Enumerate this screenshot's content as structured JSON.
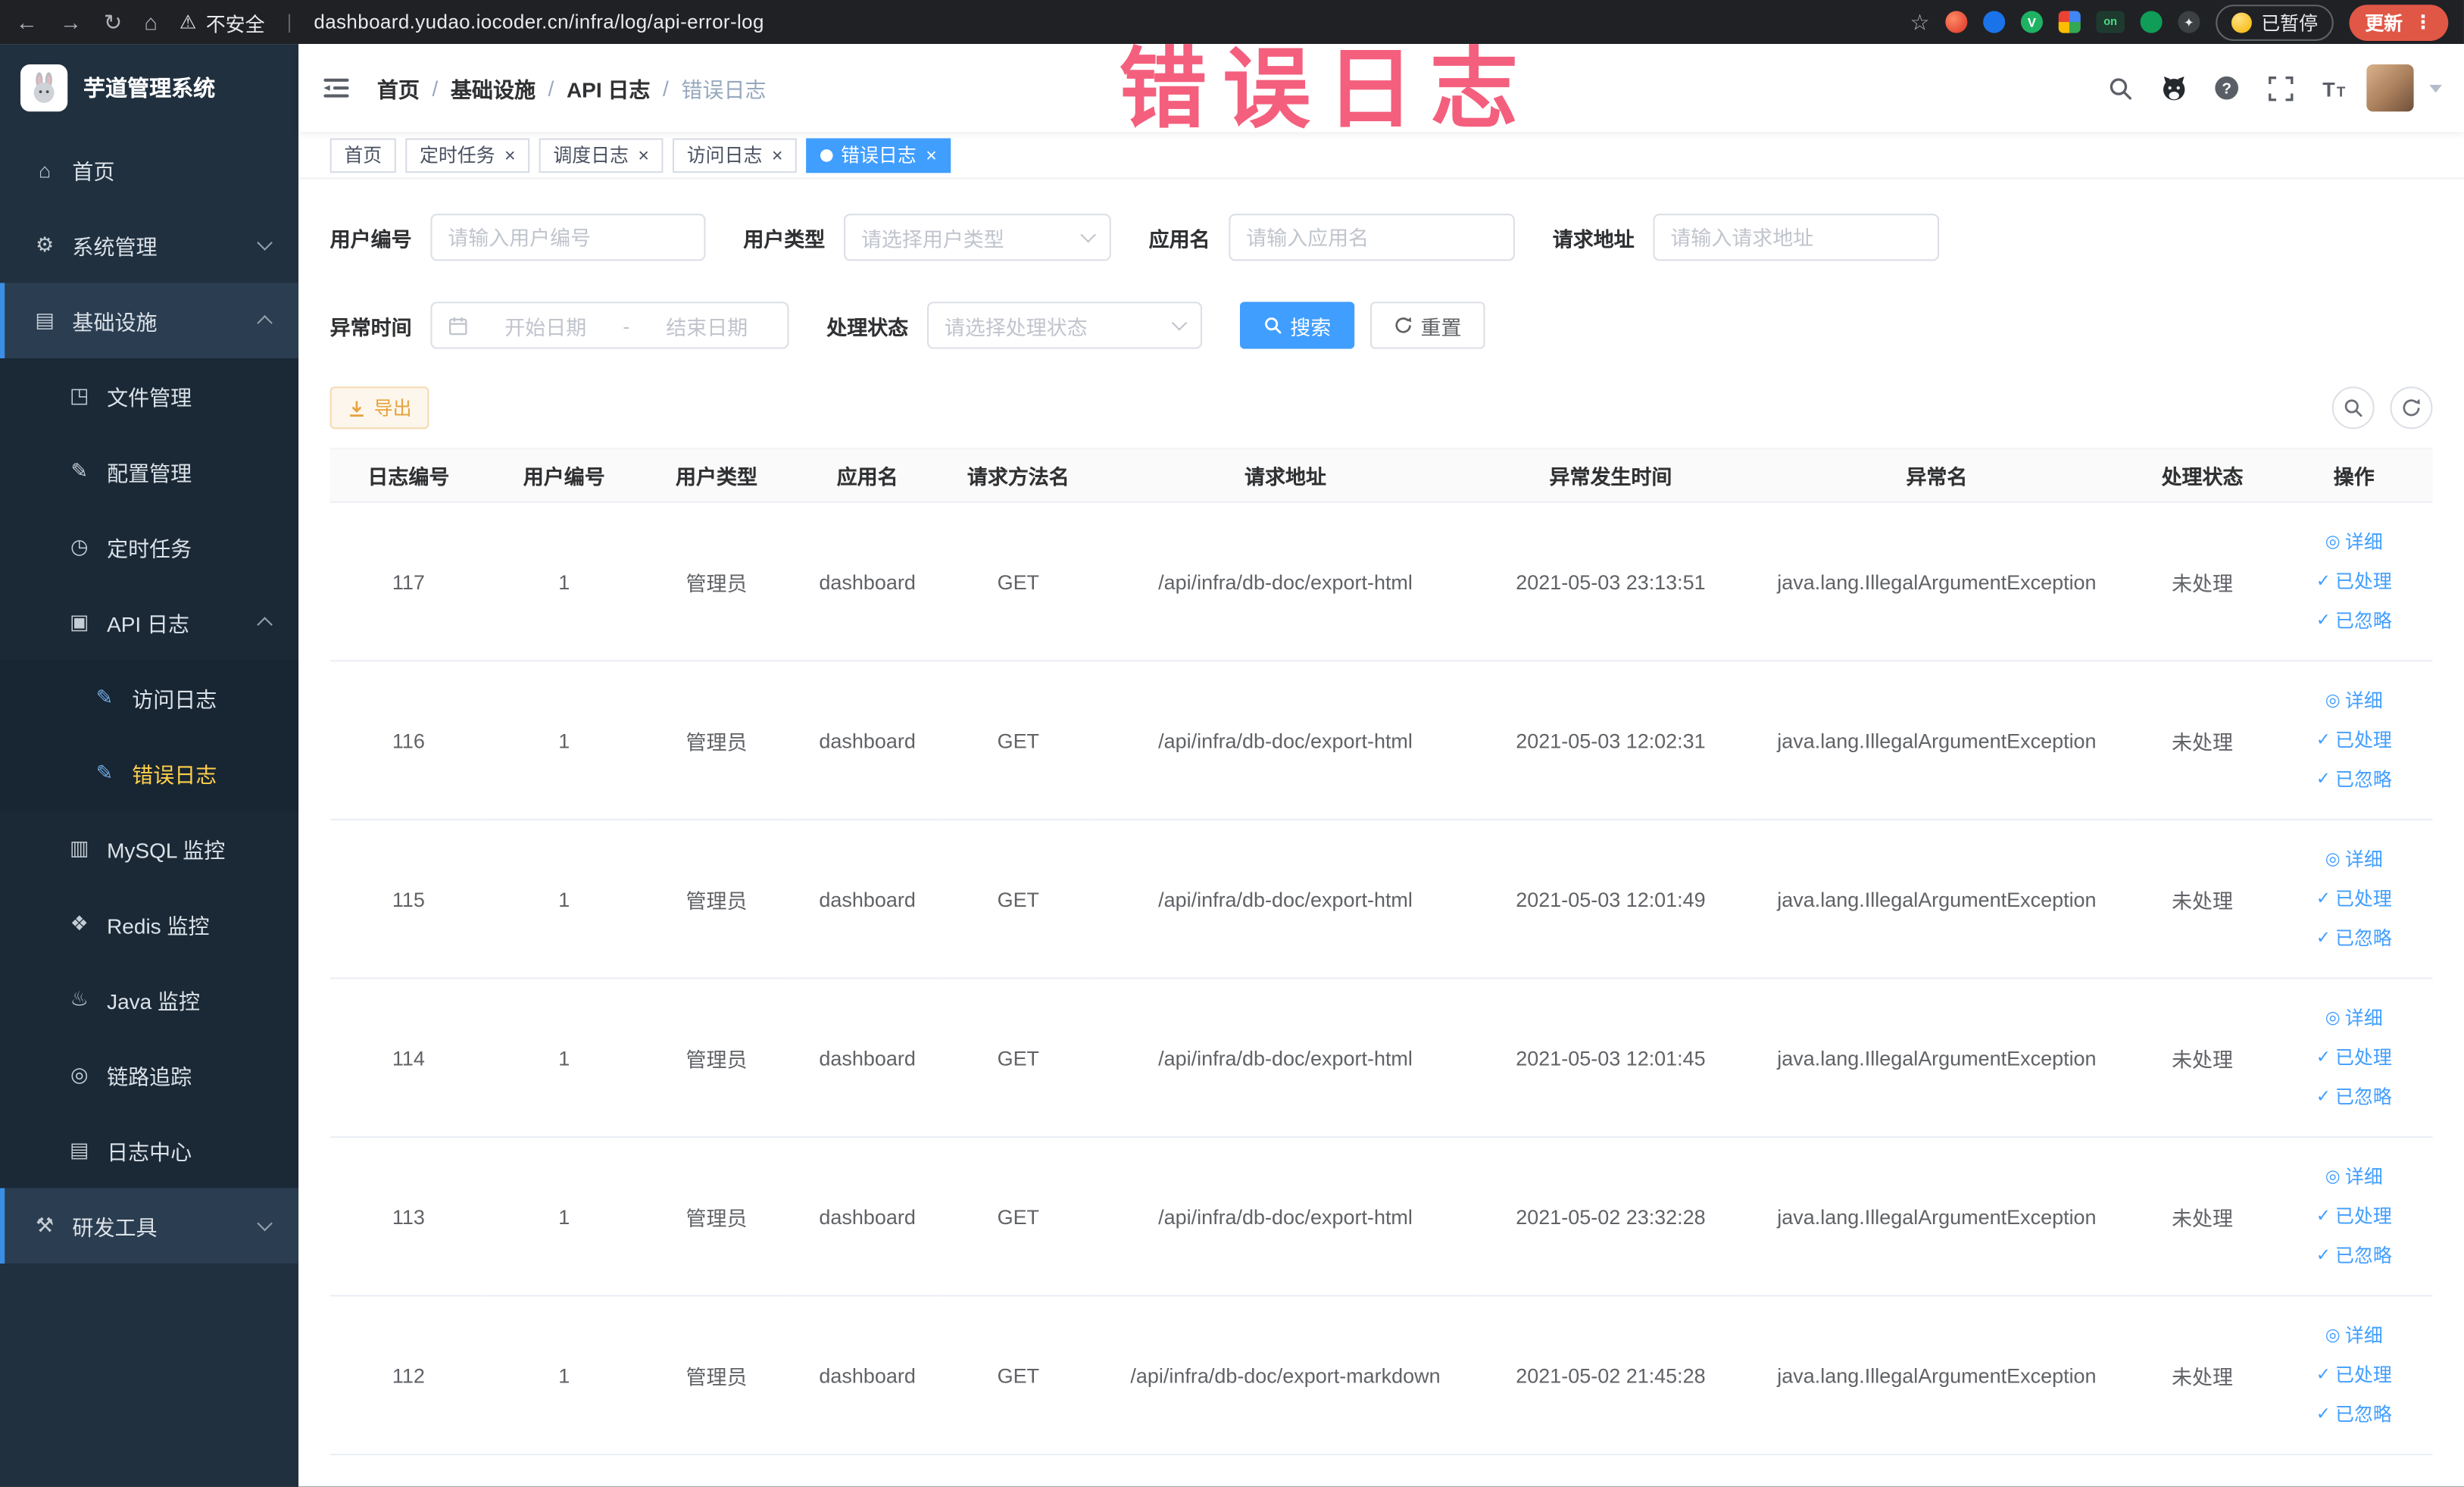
{
  "colors": {
    "accent_blue": "#409eff",
    "active_menu_yellow": "#ffd04b",
    "warning_orange": "#e6a23c",
    "annotation_pink": "#f23c60",
    "sidebar_bg": "#20303f",
    "chrome_bg": "#202124",
    "update_chip_red": "#e05746"
  },
  "icons": {
    "back-icon": "←",
    "forward-icon": "→",
    "reload-icon": "↻",
    "browser-home-icon": "⌂",
    "warning-icon": "⚠",
    "star-icon": "☆",
    "kebab-icon": "⋮",
    "on-badge-icon": "on",
    "home-icon": "⌂",
    "gear-icon": "⚙",
    "grid-icon": "▤",
    "folder-icon": "◳",
    "config-icon": "✎",
    "timer-icon": "◷",
    "api-log-icon": "▣",
    "access-log-icon": "✎",
    "error-log-icon": "✎",
    "mysql-icon": "▥",
    "redis-icon": "❖",
    "java-icon": "♨",
    "trace-icon": "◎",
    "log-center-icon": "▤",
    "tools-icon": "⚒",
    "detail-icon": "◎",
    "check-icon": "✓"
  },
  "browser": {
    "security_label": "不安全",
    "url": "dashboard.yudao.iocoder.cn/infra/log/api-error-log",
    "paused_label": "已暂停",
    "update_label": "更新"
  },
  "annotation": {
    "text": "错误日志"
  },
  "sidebar": {
    "logo_title": "芋道管理系统",
    "menu": [
      {
        "label": "首页",
        "icon": "home-icon",
        "level": 1
      },
      {
        "label": "系统管理",
        "icon": "gear-icon",
        "level": 1,
        "chevron": "down"
      },
      {
        "label": "基础设施",
        "icon": "grid-icon",
        "level": 1,
        "chevron": "up",
        "highlight": true
      },
      {
        "label": "文件管理",
        "icon": "folder-icon",
        "level": 2
      },
      {
        "label": "配置管理",
        "icon": "config-icon",
        "level": 2
      },
      {
        "label": "定时任务",
        "icon": "timer-icon",
        "level": 2
      },
      {
        "label": "API 日志",
        "icon": "api-log-icon",
        "level": 2,
        "chevron": "up"
      },
      {
        "label": "访问日志",
        "icon": "access-log-icon",
        "level": 3,
        "blue_icon": true
      },
      {
        "label": "错误日志",
        "icon": "error-log-icon",
        "level": 3,
        "blue_icon": true,
        "active": true
      },
      {
        "label": "MySQL 监控",
        "icon": "mysql-icon",
        "level": 2
      },
      {
        "label": "Redis 监控",
        "icon": "redis-icon",
        "level": 2
      },
      {
        "label": "Java 监控",
        "icon": "java-icon",
        "level": 2
      },
      {
        "label": "链路追踪",
        "icon": "trace-icon",
        "level": 2
      },
      {
        "label": "日志中心",
        "icon": "log-center-icon",
        "level": 2
      },
      {
        "label": "研发工具",
        "icon": "tools-icon",
        "level": 1,
        "chevron": "down",
        "highlight": true
      }
    ]
  },
  "header": {
    "breadcrumb": [
      "首页",
      "基础设施",
      "API 日志",
      "错误日志"
    ]
  },
  "ui": {
    "close_glyph": "×"
  },
  "tabs": [
    {
      "label": "首页",
      "closable": false,
      "active": false
    },
    {
      "label": "定时任务",
      "closable": true,
      "active": false
    },
    {
      "label": "调度日志",
      "closable": true,
      "active": false
    },
    {
      "label": "访问日志",
      "closable": true,
      "active": false
    },
    {
      "label": "错误日志",
      "closable": true,
      "active": true
    }
  ],
  "filters": {
    "user_id_label": "用户编号",
    "user_id_placeholder": "请输入用户编号",
    "user_type_label": "用户类型",
    "user_type_placeholder": "请选择用户类型",
    "app_name_label": "应用名",
    "app_name_placeholder": "请输入应用名",
    "request_url_label": "请求地址",
    "request_url_placeholder": "请输入请求地址",
    "exception_time_label": "异常时间",
    "start_date_placeholder": "开始日期",
    "range_separator": "-",
    "end_date_placeholder": "结束日期",
    "process_status_label": "处理状态",
    "process_status_placeholder": "请选择处理状态",
    "search_button": "搜索",
    "reset_button": "重置"
  },
  "toolbar": {
    "export_label": "导出"
  },
  "table": {
    "columns": [
      "日志编号",
      "用户编号",
      "用户类型",
      "应用名",
      "请求方法名",
      "请求地址",
      "异常发生时间",
      "异常名",
      "处理状态",
      "操作"
    ],
    "actions": {
      "detail": "详细",
      "processed": "已处理",
      "ignored": "已忽略"
    },
    "rows": [
      {
        "id": "117",
        "user_id": "1",
        "user_type": "管理员",
        "app": "dashboard",
        "method": "GET",
        "url": "/api/infra/db-doc/export-html",
        "time": "2021-05-03 23:13:51",
        "exception": "java.lang.IllegalArgumentException",
        "status": "未处理"
      },
      {
        "id": "116",
        "user_id": "1",
        "user_type": "管理员",
        "app": "dashboard",
        "method": "GET",
        "url": "/api/infra/db-doc/export-html",
        "time": "2021-05-03 12:02:31",
        "exception": "java.lang.IllegalArgumentException",
        "status": "未处理"
      },
      {
        "id": "115",
        "user_id": "1",
        "user_type": "管理员",
        "app": "dashboard",
        "method": "GET",
        "url": "/api/infra/db-doc/export-html",
        "time": "2021-05-03 12:01:49",
        "exception": "java.lang.IllegalArgumentException",
        "status": "未处理"
      },
      {
        "id": "114",
        "user_id": "1",
        "user_type": "管理员",
        "app": "dashboard",
        "method": "GET",
        "url": "/api/infra/db-doc/export-html",
        "time": "2021-05-03 12:01:45",
        "exception": "java.lang.IllegalArgumentException",
        "status": "未处理"
      },
      {
        "id": "113",
        "user_id": "1",
        "user_type": "管理员",
        "app": "dashboard",
        "method": "GET",
        "url": "/api/infra/db-doc/export-html",
        "time": "2021-05-02 23:32:28",
        "exception": "java.lang.IllegalArgumentException",
        "status": "未处理"
      },
      {
        "id": "112",
        "user_id": "1",
        "user_type": "管理员",
        "app": "dashboard",
        "method": "GET",
        "url": "/api/infra/db-doc/export-markdown",
        "time": "2021-05-02 21:45:28",
        "exception": "java.lang.IllegalArgumentException",
        "status": "未处理"
      }
    ]
  }
}
